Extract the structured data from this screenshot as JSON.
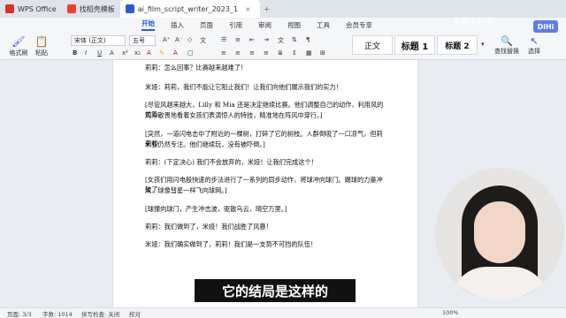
{
  "tabs": [
    {
      "label": "WPS Office",
      "color": "#d93025"
    },
    {
      "label": "找稻壳模板",
      "color": "#e8412c"
    },
    {
      "label": "ai_film_script_writer_2023_1",
      "color": "#2a5bd7"
    }
  ],
  "menu": [
    "开始",
    "插入",
    "页面",
    "引用",
    "审阅",
    "视图",
    "工具",
    "会员专享"
  ],
  "toolbar": {
    "format_painter": "格式刷",
    "paste": "粘贴",
    "font_name": "宋体 (正文)",
    "font_size": "五号",
    "styles": [
      "正文",
      "标题 1",
      "标题 2"
    ],
    "find_replace": "查找替换",
    "select": "选择"
  },
  "document": {
    "lines": [
      "莉莉：怎么回事？比赛越来越难了！",
      "米娅：莉莉，我们不能让它阻止我们！让我们向他们展示我们的实力！",
      "[尽管风越来越大，Lilly 和 Mia 还是决定继续比赛。他们调整自己的动作，利用风的优势。",
      "观众敬畏地看着女孩们表演惊人的特技，精准地在阵风中穿行。]",
      "[突然，一道闪电击中了附近的一棵树，打碎了它的树枝。人群倒吸了一口凉气，但莉莉和",
      "米亚仍然专注。他们继续玩，没有被吓倒。]",
      "莉莉：(下定决心) 我们不会放弃的，米娅！让我们完成这个！",
      "[女孩们用闪电般快速的步法进行了一系列的同步动作，将球冲向球门。踢球的力量冲破了",
      "风，球像彗星一样飞向球网。]",
      "[球撞向球门，产生冲击波，驱散乌云，晴空万里。]",
      "莉莉：我们做到了，米娅！我们战胜了风暴！",
      "米娅：我们确实做到了，莉莉！我们是一支势不可挡的队伍！"
    ]
  },
  "status": {
    "page": "页面: 3/3",
    "words": "字数: 1014",
    "spellcheck": "拼写检查: 关闭",
    "proofread": "校对",
    "zoom": "100%"
  },
  "overlay": {
    "subtitle": "它的结局是这样的",
    "watermark": "发发小报姐",
    "badge": "DiHi"
  }
}
